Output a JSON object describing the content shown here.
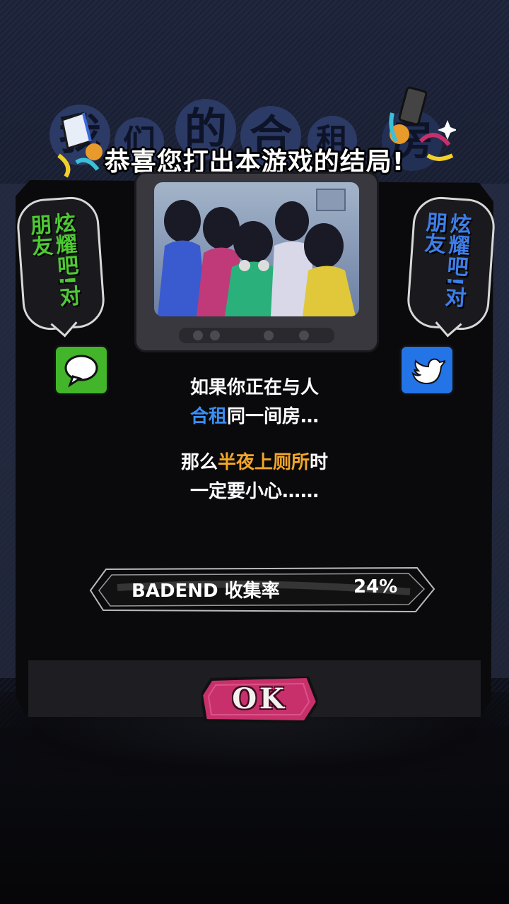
{
  "title": "恭喜您打出本游戏的结局!",
  "logo_chars": [
    "我",
    "们",
    "的",
    "合",
    "租",
    "房"
  ],
  "share_left": {
    "text": "炫耀吧!对朋友",
    "color": "#4ec934"
  },
  "share_right": {
    "text": "炫耀吧!对朋友",
    "color": "#3e7ee8"
  },
  "story": {
    "line1": "如果你正在与人",
    "line2_highlight": "合租",
    "line2_rest": "同一间房…",
    "line3_prefix": "那么",
    "line3_highlight": "半夜上厕所",
    "line3_suffix": "时",
    "line4": "一定要小心……"
  },
  "collection": {
    "label": "BADEND 收集率",
    "value": "24%",
    "percent": 24
  },
  "ok_label": "OK",
  "colors": {
    "blue": "#3a8ef5",
    "orange": "#f2a62a",
    "ok_pink": "#c8306c",
    "green": "#42b52a",
    "twitter_blue": "#2374e6"
  },
  "icons": [
    "chat-bubble-icon",
    "bird-icon"
  ]
}
